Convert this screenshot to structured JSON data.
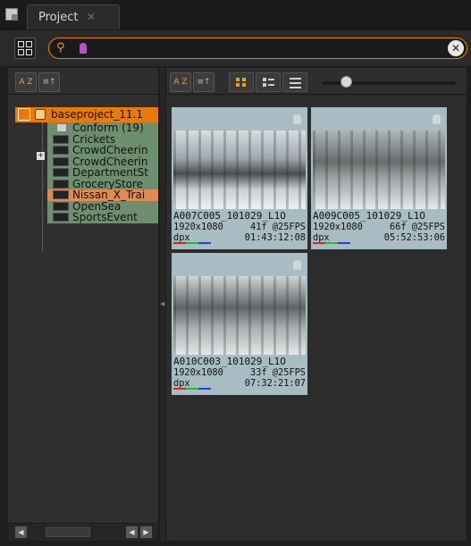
{
  "tabbar": {
    "tab_label": "Project",
    "tab_close": "✕"
  },
  "toolbar": {
    "search_placeholder": "",
    "clear_icon": "✕"
  },
  "tree": {
    "root_label": "baseproject_11.1",
    "items": [
      {
        "label": "Conform (19)",
        "type": "folder",
        "color": "green"
      },
      {
        "label": "Crickets",
        "type": "clip",
        "color": "green"
      },
      {
        "label": "CrowdCheerin",
        "type": "clip",
        "color": "green"
      },
      {
        "label": "CrowdCheerin",
        "type": "clip",
        "color": "green"
      },
      {
        "label": "DepartmentSt",
        "type": "clip",
        "color": "green"
      },
      {
        "label": "GroceryStore",
        "type": "clip",
        "color": "green"
      },
      {
        "label": "Nissan_X_Trai",
        "type": "clip",
        "color": "orange"
      },
      {
        "label": "OpenSea",
        "type": "clip",
        "color": "green"
      },
      {
        "label": "SportsEvent",
        "type": "clip",
        "color": "green"
      }
    ]
  },
  "sort_buttons": {
    "az": "A Z",
    "order": "≡↑"
  },
  "thumbnails": [
    {
      "name": "A007C005_101029_L1O",
      "resolution": "1920x1080",
      "frames": "41f @25FPS",
      "format": "dpx",
      "timecode": "01:43:12:08"
    },
    {
      "name": "A009C005_101029_L1O",
      "resolution": "1920x1080",
      "frames": "66f @25FPS",
      "format": "dpx",
      "timecode": "05:52:53:06"
    },
    {
      "name": "A010C003_101029_L1O",
      "resolution": "1920x1080",
      "frames": "33f @25FPS",
      "format": "dpx",
      "timecode": "07:32:21:07"
    }
  ],
  "colors": {
    "accent": "#e87a0c",
    "bin_green": "#6e8f6e",
    "bin_orange": "#e08a54",
    "thumb_bg": "#a8bcc4"
  }
}
